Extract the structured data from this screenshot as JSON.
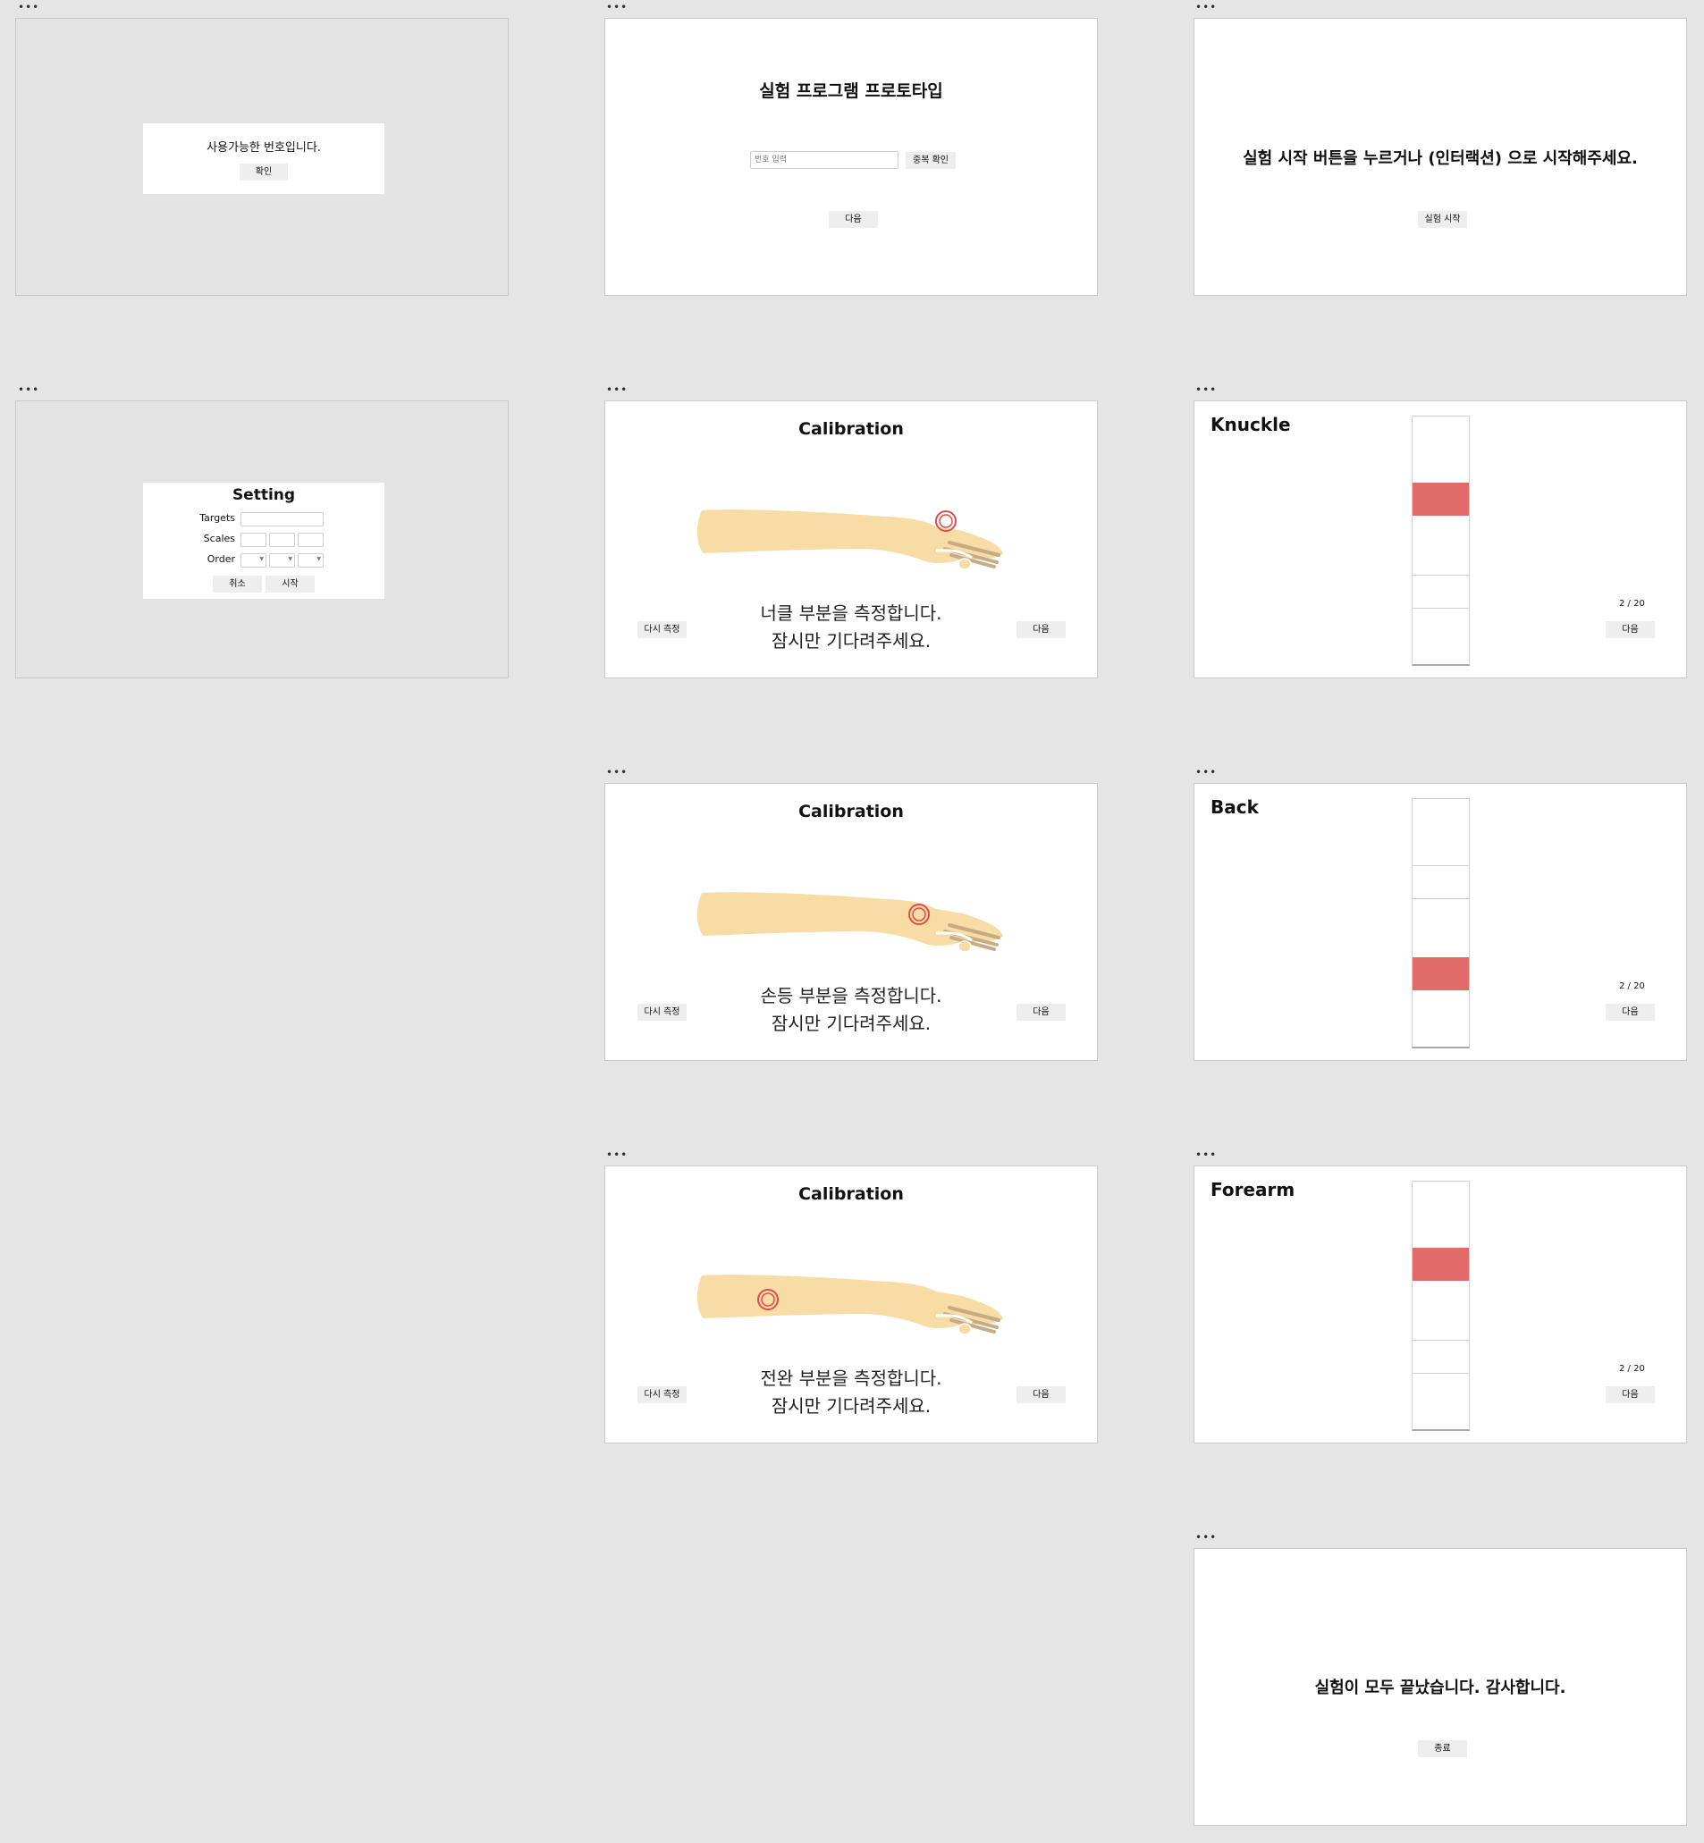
{
  "dots": "•••",
  "screen1": {
    "message": "사용가능한 번호입니다.",
    "confirm": "확인"
  },
  "screen2": {
    "title": "실험 프로그램 프로토타입",
    "input_placeholder": "번호 입력",
    "check_dup": "중복 확인",
    "next": "다음"
  },
  "screen3": {
    "message": "실험 시작 버튼을 누르거나 (인터랙션) 으로 시작해주세요.",
    "start": "실험 시작"
  },
  "setting": {
    "title": "Setting",
    "targets_label": "Targets",
    "scales_label": "Scales",
    "order_label": "Order",
    "cancel": "취소",
    "start": "시작"
  },
  "calibration": {
    "title": "Calibration",
    "retry": "다시 측정",
    "next": "다음",
    "wait": "잠시만 기다려주세요.",
    "knuckle_msg": "너클 부분을 측정합니다.",
    "back_msg": "손등 부분을 측정합니다.",
    "forearm_msg": "전완 부분을 측정합니다."
  },
  "trials": {
    "knuckle_title": "Knuckle",
    "back_title": "Back",
    "forearm_title": "Forearm",
    "counter": "2 / 20",
    "next": "다음",
    "target_color": "#e06b6b"
  },
  "end": {
    "message": "실험이 모두 끝났습니다. 감사합니다.",
    "exit": "종료"
  }
}
